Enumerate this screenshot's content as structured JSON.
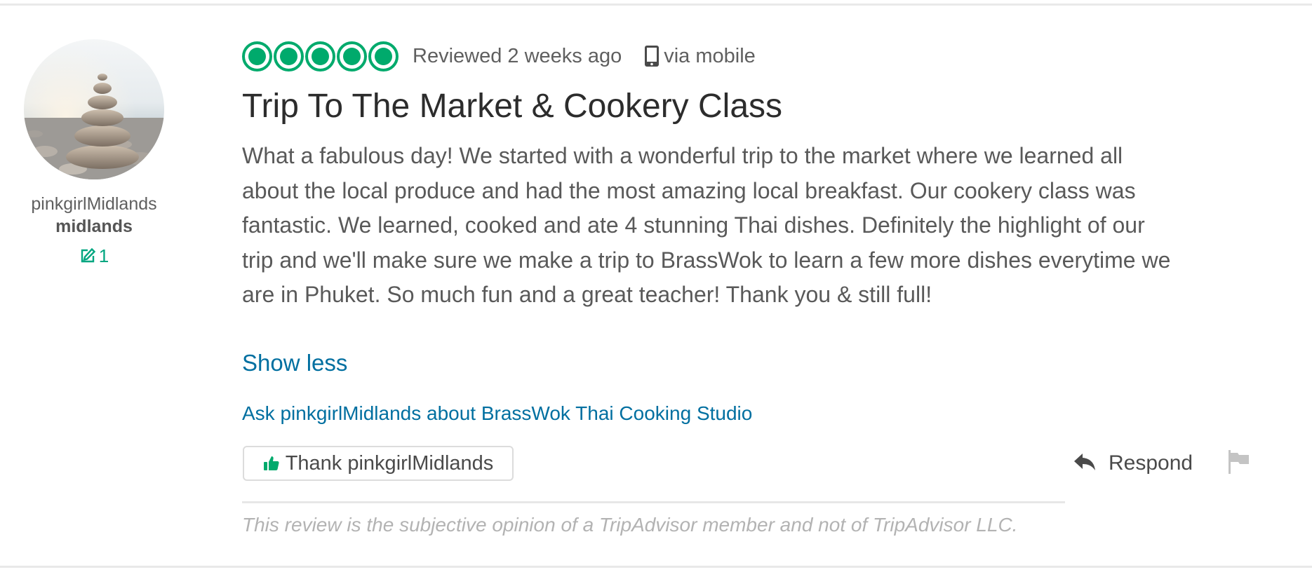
{
  "member": {
    "username": "pinkgirlMidlands",
    "location": "midlands",
    "contribution_count": "1"
  },
  "review": {
    "rating": 5,
    "rating_max": 5,
    "date": "Reviewed 2 weeks ago",
    "via": "via mobile",
    "title": "Trip To The Market & Cookery Class",
    "text": "What a fabulous day! We started with a wonderful trip to the market where we learned all about the local produce and had the most amazing local breakfast. Our cookery class was fantastic. We learned, cooked and ate 4 stunning Thai dishes. Definitely the highlight of our trip and we'll make sure we make a trip to BrassWok to learn a few more dishes everytime we are in Phuket. So much fun and a great teacher! Thank you & still full!",
    "show_less": "Show less",
    "ask_link": "Ask pinkgirlMidlands about BrassWok Thai Cooking Studio"
  },
  "actions": {
    "thank_label": "Thank pinkgirlMidlands",
    "respond_label": "Respond"
  },
  "disclaimer": "This review is the subjective opinion of a TripAdvisor member and not of TripAdvisor LLC.",
  "colors": {
    "brand_green": "#00aa6c",
    "link_blue": "#006fa0",
    "text_gray": "#595959",
    "title_dark": "#2c2c2c"
  },
  "icons": {
    "avatar": "stacked-stones-avatar",
    "rating": "rating-bubble-icon",
    "device": "mobile-phone-icon",
    "contribution": "pencil-edit-icon",
    "thank": "thumbs-up-icon",
    "respond": "reply-arrow-icon",
    "report": "flag-icon"
  }
}
